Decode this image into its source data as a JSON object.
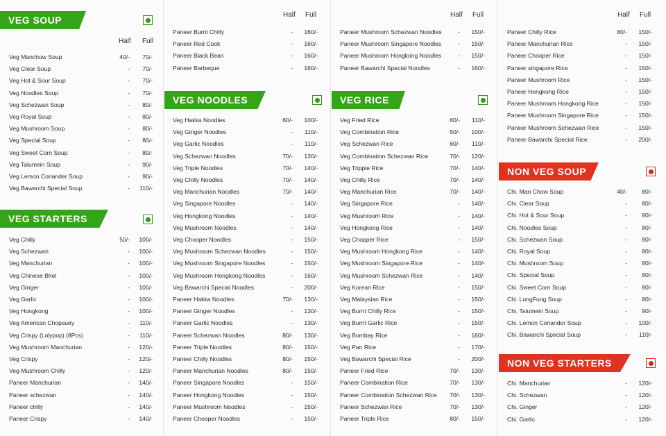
{
  "labels": {
    "half": "Half",
    "full": "Full"
  },
  "colors": {
    "veg_green": "#34a516",
    "nonveg_red": "#e0321e"
  },
  "veg_soup": {
    "title": "VEG SOUP",
    "items": [
      {
        "name": "Veg Manchow Soup",
        "half": "40/-",
        "full": "70/-"
      },
      {
        "name": "Veg Clear Soup",
        "half": "-",
        "full": "70/-"
      },
      {
        "name": "Veg Hot & Sour Soup",
        "half": "-",
        "full": "70/-"
      },
      {
        "name": "Veg Noodles Soup",
        "half": "-",
        "full": "70/-"
      },
      {
        "name": "Veg Schezwan Soup",
        "half": "-",
        "full": "80/-"
      },
      {
        "name": "Veg Royal Soup",
        "half": "-",
        "full": "80/-"
      },
      {
        "name": "Veg Mushroom Soup",
        "half": "-",
        "full": "80/-"
      },
      {
        "name": "Veg Special Soup",
        "half": "-",
        "full": "80/-"
      },
      {
        "name": "Veg Sweet Corn Soup",
        "half": "-",
        "full": "80/-"
      },
      {
        "name": "Veg Talumein Soup",
        "half": "-",
        "full": "90/-"
      },
      {
        "name": "Veg Lemon Coriander Soup",
        "half": "-",
        "full": "90/-"
      },
      {
        "name": "Veg Bawarchi Special Soup",
        "half": "-",
        "full": "110/-"
      }
    ]
  },
  "veg_starters": {
    "title": "VEG STARTERS",
    "items": [
      {
        "name": "Veg Chilly",
        "half": "50/-",
        "full": "100/-"
      },
      {
        "name": "Veg Schezwan",
        "half": "-",
        "full": "100/-"
      },
      {
        "name": "Veg Manchurian",
        "half": "-",
        "full": "100/-"
      },
      {
        "name": "Veg Chinese Bhel",
        "half": "-",
        "full": "100/-"
      },
      {
        "name": "Veg Ginger",
        "half": "-",
        "full": "100/-"
      },
      {
        "name": "Veg Garlic",
        "half": "-",
        "full": "100/-"
      },
      {
        "name": "Veg Hongkong",
        "half": "-",
        "full": "100/-"
      },
      {
        "name": "Veg American Chopsuey",
        "half": "-",
        "full": "110/-"
      },
      {
        "name": "Veg Crispy (Lolypop) (8Pcs)",
        "half": "-",
        "full": "110/-"
      },
      {
        "name": "Veg Mushroom Manchurian",
        "half": "-",
        "full": "120/-"
      },
      {
        "name": "Veg Crispy",
        "half": "-",
        "full": "120/-"
      },
      {
        "name": "Veg Mushroom Chilly",
        "half": "-",
        "full": "120/-"
      },
      {
        "name": "Paneer Manchurian",
        "half": "-",
        "full": "140/-"
      },
      {
        "name": "Paneer schezwan",
        "half": "-",
        "full": "140/-"
      },
      {
        "name": "Paneer chilly",
        "half": "-",
        "full": "140/-"
      },
      {
        "name": "Paneer Crispy",
        "half": "-",
        "full": "140/-"
      }
    ]
  },
  "paneer_cont": {
    "items": [
      {
        "name": "Paneer Burnt Chilly",
        "half": "-",
        "full": "160/-"
      },
      {
        "name": "Paneer Red Cook",
        "half": "-",
        "full": "160/-"
      },
      {
        "name": "Paneer Black Bean",
        "half": "-",
        "full": "160/-"
      },
      {
        "name": "Paneer Barbeque",
        "half": "-",
        "full": "160/-"
      }
    ]
  },
  "veg_noodles": {
    "title": "VEG NOODLES",
    "items": [
      {
        "name": "Veg Hakka Noodles",
        "half": "60/-",
        "full": "100/-"
      },
      {
        "name": "Veg Ginger Noodles",
        "half": "-",
        "full": "110/-"
      },
      {
        "name": "Veg Garlic Noodles",
        "half": "-",
        "full": "110/-"
      },
      {
        "name": "Veg Schezwan Noodles",
        "half": "70/-",
        "full": "130/-"
      },
      {
        "name": "Veg Triple Noodles",
        "half": "70/-",
        "full": "140/-"
      },
      {
        "name": "Veg Chilly Noodles",
        "half": "70/-",
        "full": "140/-"
      },
      {
        "name": "Veg Manchurian Noodles",
        "half": "70/-",
        "full": "140/-"
      },
      {
        "name": "Veg Singapore Noodles",
        "half": "-",
        "full": "140/-"
      },
      {
        "name": "Veg Hongkong Noodles",
        "half": "-",
        "full": "140/-"
      },
      {
        "name": "Veg Mushroom Noodles",
        "half": "-",
        "full": "140/-"
      },
      {
        "name": "Veg Chooper Noodles",
        "half": "-",
        "full": "150/-"
      },
      {
        "name": "Veg Mushroom Schezwan Noodles",
        "half": "-",
        "full": "150/-"
      },
      {
        "name": "Veg Mushroom Singapore Noodles",
        "half": "-",
        "full": "150/-"
      },
      {
        "name": "Veg Mushroom Hongkong Noodles",
        "half": "-",
        "full": "160/-"
      },
      {
        "name": "Veg Bawarchi Special Noodles",
        "half": "-",
        "full": "200/-"
      },
      {
        "name": "Paneer Hakka Noodles",
        "half": "70/-",
        "full": "130/-"
      },
      {
        "name": "Paneer Ginger Noodles",
        "half": "-",
        "full": "130/-"
      },
      {
        "name": "Paneer Garlic Noodles",
        "half": "-",
        "full": "130/-"
      },
      {
        "name": "Paneer Schezwan Noodles",
        "half": "80/-",
        "full": "130/-"
      },
      {
        "name": "Paneer Triple Noodles",
        "half": "80/-",
        "full": "150/-"
      },
      {
        "name": "Paneer Chilly Noodles",
        "half": "80/-",
        "full": "150/-"
      },
      {
        "name": "Paneer Manchurian Noodles",
        "half": "80/-",
        "full": "150/-"
      },
      {
        "name": "Paneer Singapore Noodles",
        "half": "-",
        "full": "150/-"
      },
      {
        "name": "Paneer Hongkong Noodles",
        "half": "-",
        "full": "150/-"
      },
      {
        "name": "Paneer Mushroom Noodles",
        "half": "-",
        "full": "150/-"
      },
      {
        "name": "Paneer Chooper Noodles",
        "half": "-",
        "full": "150/-"
      }
    ]
  },
  "noodles_cont": {
    "items": [
      {
        "name": "Paneer Mushroom Schezwan Noodles",
        "half": "-",
        "full": "150/-"
      },
      {
        "name": "Paneer Mushroom Singapore Noodles",
        "half": "-",
        "full": "150/-"
      },
      {
        "name": "Paneer Mushroom Hongkong Noodles",
        "half": "-",
        "full": "150/-"
      },
      {
        "name": "Paneer Bawarchi Special Noodles",
        "half": "-",
        "full": "160/-"
      }
    ]
  },
  "veg_rice": {
    "title": "VEG RICE",
    "items": [
      {
        "name": "Veg Fried Rice",
        "half": "60/-",
        "full": "110/-"
      },
      {
        "name": "Veg Combination Rice",
        "half": "50/-",
        "full": "100/-"
      },
      {
        "name": "Veg Schezwan Rice",
        "half": "60/-",
        "full": "110/-"
      },
      {
        "name": "Veg Combination Schezwan Rice",
        "half": "70/-",
        "full": "120/-"
      },
      {
        "name": "Veg Tripple Rice",
        "half": "70/-",
        "full": "140/-"
      },
      {
        "name": "Veg Chilly Rice",
        "half": "70/-",
        "full": "140/-"
      },
      {
        "name": "Veg Manchurian Rice",
        "half": "70/-",
        "full": "140/-"
      },
      {
        "name": "Veg Singapore Rice",
        "half": "-",
        "full": "140/-"
      },
      {
        "name": "Veg Mushroom Rice",
        "half": "-",
        "full": "140/-"
      },
      {
        "name": "Veg Hongkong Rice",
        "half": "-",
        "full": "140/-"
      },
      {
        "name": "Veg Chopper Rice",
        "half": "-",
        "full": "150/-"
      },
      {
        "name": "Veg Mushroom Hongkong Rice",
        "half": "-",
        "full": "140/-"
      },
      {
        "name": "Veg Mushroom Singapore Rice",
        "half": "-",
        "full": "140/-"
      },
      {
        "name": "Veg Mushroom Schezwan Rice",
        "half": "-",
        "full": "140/-"
      },
      {
        "name": "Veg Korean Rice",
        "half": "-",
        "full": "150/-"
      },
      {
        "name": "Veg Malaysian Rice",
        "half": "-",
        "full": "150/-"
      },
      {
        "name": "Veg Burnt Chilly Rice",
        "half": "-",
        "full": "150/-"
      },
      {
        "name": "Veg Burnt Garlic Rice",
        "half": "-",
        "full": "150/-"
      },
      {
        "name": "Veg Bombay Rice",
        "half": "-",
        "full": "160/-"
      },
      {
        "name": "Veg Pan Rice",
        "half": "-",
        "full": "170/-"
      },
      {
        "name": "Veg Bawarchi Special Rice",
        "half": "-",
        "full": "200/-"
      },
      {
        "name": "Paneer Fried Rice",
        "half": "70/-",
        "full": "130/-"
      },
      {
        "name": "Paneer Combination Rice",
        "half": "70/-",
        "full": "130/-"
      },
      {
        "name": "Paneer Combination Schezwan Rice",
        "half": "70/-",
        "full": "130/-"
      },
      {
        "name": "Paneer Schezwan Rice",
        "half": "70/-",
        "full": "130/-"
      },
      {
        "name": "Paneer Triple Rice",
        "half": "80/-",
        "full": "150/-"
      }
    ]
  },
  "rice_cont": {
    "items": [
      {
        "name": "Paneer Chilly Rice",
        "half": "80/-",
        "full": "150/-"
      },
      {
        "name": "Paneer Manchurian Rice",
        "half": "-",
        "full": "150/-"
      },
      {
        "name": "Paneer Chooper Rice",
        "half": "-",
        "full": "150/-"
      },
      {
        "name": "Paneer singapore Rice",
        "half": "-",
        "full": "150/-"
      },
      {
        "name": "Paneer Mushroom Rice",
        "half": "-",
        "full": "150/-"
      },
      {
        "name": "Paneer Hongkong Rice",
        "half": "-",
        "full": "150/-"
      },
      {
        "name": "Paneer Mushroom Hongkong Rice",
        "half": "-",
        "full": "150/-"
      },
      {
        "name": "Paneer Mushroom Singapore Rice",
        "half": "-",
        "full": "150/-"
      },
      {
        "name": "Paneer Mushroom Schezwan Rice",
        "half": "-",
        "full": "150/-"
      },
      {
        "name": "Paneer Bawarchi Special Rice",
        "half": "-",
        "full": "200/-"
      }
    ]
  },
  "nonveg_soup": {
    "title": "NON VEG SOUP",
    "items": [
      {
        "name": "Chi. Man Chow Soup",
        "half": "40/-",
        "full": "80/-"
      },
      {
        "name": "Chi. Clear Soup",
        "half": "-",
        "full": "80/-"
      },
      {
        "name": "Chi. Hot & Sour Soup",
        "half": "-",
        "full": "80/-"
      },
      {
        "name": "Chi. Noodles Soup",
        "half": "-",
        "full": "80/-"
      },
      {
        "name": "Chi. Schezwan Soup",
        "half": "-",
        "full": "80/-"
      },
      {
        "name": "Chi. Royal Soup",
        "half": "-",
        "full": "80/-"
      },
      {
        "name": "Chi. Mushroom Soup",
        "half": "-",
        "full": "80/-"
      },
      {
        "name": "Chi. Special Soup",
        "half": "-",
        "full": "80/-"
      },
      {
        "name": "Chi. Sweet Corn Soup",
        "half": "-",
        "full": "80/-"
      },
      {
        "name": "Chi. LungFung Soup",
        "half": "-",
        "full": "80/-"
      },
      {
        "name": "Chi. Talumein Soup",
        "half": "-",
        "full": "90/-"
      },
      {
        "name": "Chi. Lemon Coriander Soup",
        "half": "-",
        "full": "100/-"
      },
      {
        "name": "Chi. Bawarchi Special Soup",
        "half": "-",
        "full": "110/-"
      }
    ]
  },
  "nonveg_starters": {
    "title": "NON VEG STARTERS",
    "items": [
      {
        "name": "Chi. Manchurian",
        "half": "-",
        "full": "120/-"
      },
      {
        "name": "Chi. Schezwan",
        "half": "-",
        "full": "120/-"
      },
      {
        "name": "Chi. Ginger",
        "half": "-",
        "full": "120/-"
      },
      {
        "name": "Chi. Garlic",
        "half": "-",
        "full": "120/-"
      }
    ]
  }
}
